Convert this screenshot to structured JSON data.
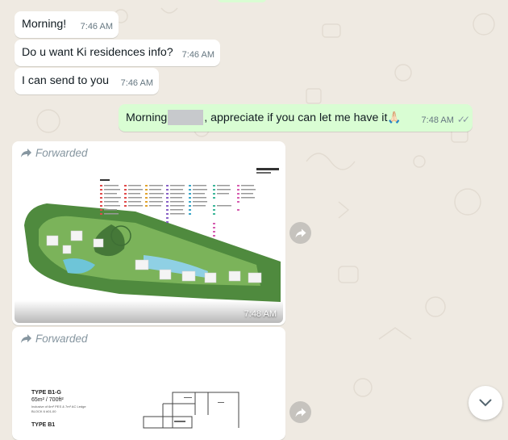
{
  "colors": {
    "wallpaper": "#efeae2",
    "incoming_bubble": "#ffffff",
    "outgoing_bubble": "#d9fdd3",
    "meta_text": "#667781",
    "read_ticks": "#8696a0"
  },
  "messages": {
    "m1": {
      "text": "Morning!",
      "time": "7:46 AM"
    },
    "m2": {
      "text": "Do u want Ki residences info?",
      "time": "7:46 AM"
    },
    "m3": {
      "text": "I can send to you",
      "time": "7:46 AM"
    },
    "m4": {
      "text_before": "Morning",
      "text_after": ", appreciate if you can let me have it",
      "emoji": "🙏🏻",
      "time": "7:48 AM",
      "ticks": "✓✓"
    }
  },
  "media": {
    "site_plan": {
      "forwarded_label": "Forwarded",
      "time": "7:48 AM",
      "icon": "forward-arrow-icon"
    },
    "floor_plan": {
      "forwarded_label": "Forwarded",
      "icon": "forward-arrow-icon",
      "type1": "TYPE B1-G",
      "area1": "65m² / 700ft²",
      "note1": "Inclusive of 6m² PES & 7m² AC Ledge",
      "block1": "BLOCK 6   #01-00",
      "type2": "TYPE B1"
    }
  },
  "icons": {
    "forward_button": "forward-icon",
    "scroll_down": "chevron-down-icon"
  }
}
